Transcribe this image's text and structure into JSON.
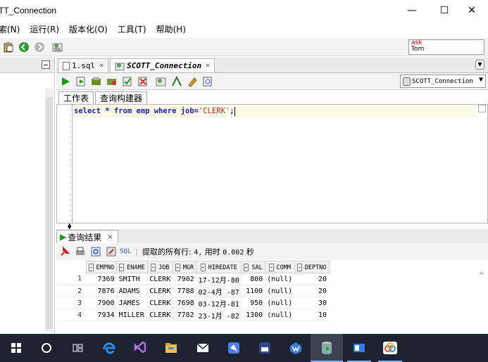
{
  "window": {
    "title": "TT_Connection",
    "minimize": "—",
    "maximize": "☐",
    "close": "✕"
  },
  "menu": [
    {
      "label": "索(N)"
    },
    {
      "label": "运行(R)"
    },
    {
      "label": "版本化(O)"
    },
    {
      "label": "工具(T)"
    },
    {
      "label": "帮助(H)"
    }
  ],
  "user_box": {
    "line1": "ask",
    "line2": "Tom"
  },
  "editor_tabs": [
    {
      "label": "1.sql",
      "close": "×"
    },
    {
      "label": "SCOTT_Connection",
      "close": "×"
    }
  ],
  "connection": {
    "selected": "SCOTT_Connection"
  },
  "worksheet_tabs": [
    {
      "label": "工作表"
    },
    {
      "label": "查询构建器"
    }
  ],
  "code": {
    "keyword_part": "select * from emp where job=",
    "string_part": "'CLERK'",
    "end": ";"
  },
  "results": {
    "tab_label": "查询结果",
    "tab_close": "×",
    "sql_tag": "SQL",
    "message_prefix": "提取的所有行: ",
    "rows_count": "4,",
    "time_label": " 用时 ",
    "time_value": "0.002",
    "time_unit": " 秒",
    "columns": [
      "EMPNO",
      "ENAME",
      "JOB",
      "MGR",
      "HIREDATE",
      "SAL",
      "COMM",
      "DEPTNO"
    ],
    "rows": [
      {
        "n": "1",
        "empno": "7369",
        "ename": "SMITH",
        "job": "CLERK",
        "mgr": "7902",
        "hiredate": "17-12月-80",
        "sal": "800",
        "comm": "(null)",
        "deptno": "20"
      },
      {
        "n": "2",
        "empno": "7876",
        "ename": "ADAMS",
        "job": "CLERK",
        "mgr": "7788",
        "hiredate": "02-4月 -87",
        "sal": "1100",
        "comm": "(null)",
        "deptno": "20"
      },
      {
        "n": "3",
        "empno": "7900",
        "ename": "JAMES",
        "job": "CLERK",
        "mgr": "7698",
        "hiredate": "03-12月-81",
        "sal": "950",
        "comm": "(null)",
        "deptno": "30"
      },
      {
        "n": "4",
        "empno": "7934",
        "ename": "MILLER",
        "job": "CLERK",
        "mgr": "7782",
        "hiredate": "23-1月 -82",
        "sal": "1300",
        "comm": "(null)",
        "deptno": "10"
      }
    ]
  },
  "colors": {
    "accent": "#1a9b1a",
    "keyword": "#1a1aa6",
    "string": "#c03030",
    "taskbar": "#1c2330"
  },
  "taskbar_icons": [
    "windows-start-icon",
    "cortana-circle-icon",
    "task-view-icon",
    "edge-browser-icon",
    "visual-studio-icon",
    "file-explorer-icon",
    "mail-icon",
    "app-blue-icon",
    "app-dark-icon",
    "wps-icon",
    "sql-developer-icon",
    "app-window-icon",
    "app-rings-icon"
  ]
}
